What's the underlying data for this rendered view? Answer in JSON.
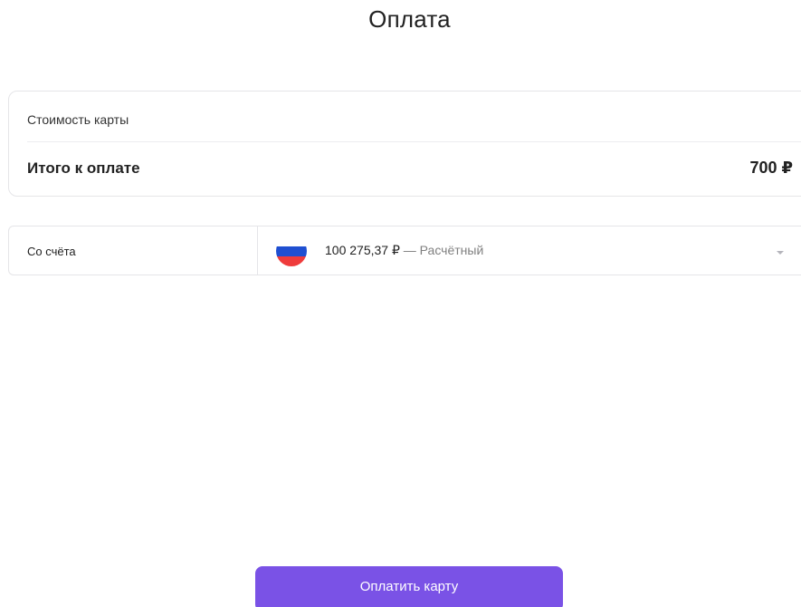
{
  "page": {
    "title": "Оплата"
  },
  "summary": {
    "card_cost_label": "Стоимость карты",
    "total_label": "Итого к оплате",
    "total_value": "700 ₽"
  },
  "account": {
    "label": "Со счёта",
    "balance": "100 275,37 ₽",
    "separator": " — ",
    "type": "Расчётный",
    "flag_icon": "russia-flag-icon",
    "dropdown_icon": "chevron-down-icon"
  },
  "actions": {
    "pay_label": "Оплатить карту"
  },
  "colors": {
    "accent": "#7a52e6",
    "border": "#e5e5e8",
    "muted_text": "#808080",
    "flag_white": "#ffffff",
    "flag_blue": "#1f4fd1",
    "flag_red": "#ef3b3b"
  }
}
